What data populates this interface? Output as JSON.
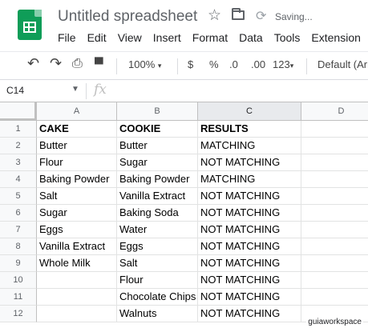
{
  "title": {
    "doc_title": "Untitled spreadsheet",
    "status": "Saving..."
  },
  "menu": [
    "File",
    "Edit",
    "View",
    "Insert",
    "Format",
    "Data",
    "Tools",
    "Extension"
  ],
  "toolbar": {
    "zoom": "100%",
    "currency": "$",
    "percent": "%",
    "decimal_decrease": ".0",
    "decimal_increase": ".00",
    "more_formats": "123",
    "font": "Default (Ari"
  },
  "formula_bar": {
    "name_box": "C14",
    "fx": "fx"
  },
  "grid": {
    "columns": [
      "A",
      "B",
      "C",
      "D"
    ],
    "rows": [
      "1",
      "2",
      "3",
      "4",
      "5",
      "6",
      "7",
      "8",
      "9",
      "10",
      "11",
      "12"
    ],
    "cells": [
      [
        "CAKE",
        "COOKIE",
        "RESULTS"
      ],
      [
        "Butter",
        "Butter",
        "MATCHING"
      ],
      [
        "Flour",
        "Sugar",
        "NOT MATCHING"
      ],
      [
        "Baking Powder",
        "Baking Powder",
        "MATCHING"
      ],
      [
        "Salt",
        "Vanilla Extract",
        "NOT MATCHING"
      ],
      [
        "Sugar",
        "Baking Soda",
        "NOT MATCHING"
      ],
      [
        "Eggs",
        "Water",
        "NOT MATCHING"
      ],
      [
        "Vanilla Extract",
        "Eggs",
        "NOT MATCHING"
      ],
      [
        "Whole Milk",
        "Salt",
        "NOT MATCHING"
      ],
      [
        "",
        "Flour",
        "NOT MATCHING"
      ],
      [
        "",
        "Chocolate Chips",
        "NOT MATCHING"
      ],
      [
        "",
        "Walnuts",
        "NOT MATCHING"
      ]
    ],
    "selected_column": "C"
  },
  "watermark": "guiaworkspace"
}
